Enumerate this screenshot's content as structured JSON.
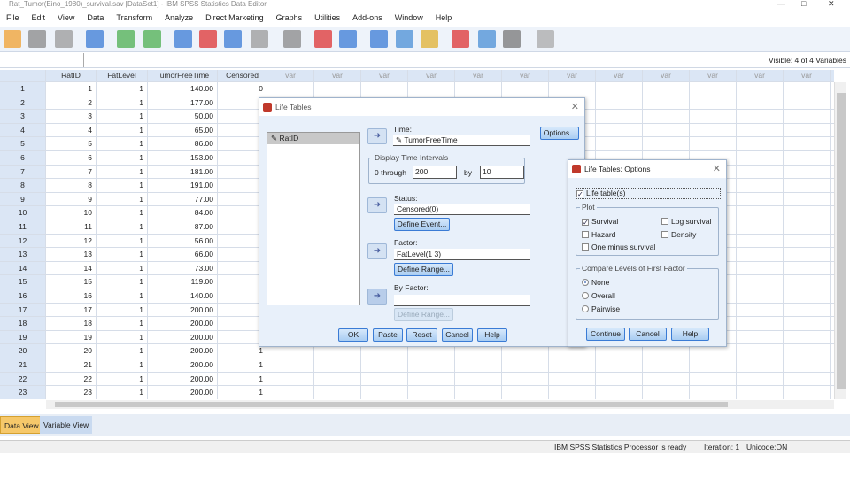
{
  "window": {
    "title": "Rat_Tumor(Eino_1980)_survival.sav [DataSet1] - IBM SPSS Statistics Data Editor"
  },
  "menu": [
    "File",
    "Edit",
    "View",
    "Data",
    "Transform",
    "Analyze",
    "Direct Marketing",
    "Graphs",
    "Utilities",
    "Add-ons",
    "Window",
    "Help"
  ],
  "editbar": {
    "visible": "Visible: 4 of 4 Variables"
  },
  "grid": {
    "columns": [
      "RatID",
      "FatLevel",
      "TumorFreeTime",
      "Censored",
      "var",
      "var",
      "var",
      "var",
      "var",
      "var",
      "var",
      "var",
      "var",
      "var",
      "var",
      "var",
      "var"
    ],
    "rows": [
      [
        "1",
        "1",
        "1",
        "140.00",
        "0"
      ],
      [
        "2",
        "2",
        "1",
        "177.00",
        ""
      ],
      [
        "3",
        "3",
        "1",
        "50.00",
        ""
      ],
      [
        "4",
        "4",
        "1",
        "65.00",
        ""
      ],
      [
        "5",
        "5",
        "1",
        "86.00",
        ""
      ],
      [
        "6",
        "6",
        "1",
        "153.00",
        ""
      ],
      [
        "7",
        "7",
        "1",
        "181.00",
        ""
      ],
      [
        "8",
        "8",
        "1",
        "191.00",
        ""
      ],
      [
        "9",
        "9",
        "1",
        "77.00",
        ""
      ],
      [
        "10",
        "10",
        "1",
        "84.00",
        ""
      ],
      [
        "11",
        "11",
        "1",
        "87.00",
        ""
      ],
      [
        "12",
        "12",
        "1",
        "56.00",
        ""
      ],
      [
        "13",
        "13",
        "1",
        "66.00",
        ""
      ],
      [
        "14",
        "14",
        "1",
        "73.00",
        ""
      ],
      [
        "15",
        "15",
        "1",
        "119.00",
        ""
      ],
      [
        "16",
        "16",
        "1",
        "140.00",
        ""
      ],
      [
        "17",
        "17",
        "1",
        "200.00",
        ""
      ],
      [
        "18",
        "18",
        "1",
        "200.00",
        ""
      ],
      [
        "19",
        "19",
        "1",
        "200.00",
        ""
      ],
      [
        "20",
        "20",
        "1",
        "200.00",
        "1"
      ],
      [
        "21",
        "21",
        "1",
        "200.00",
        "1"
      ],
      [
        "22",
        "22",
        "1",
        "200.00",
        "1"
      ],
      [
        "23",
        "23",
        "1",
        "200.00",
        "1"
      ]
    ]
  },
  "tabs": {
    "data_view": "Data View",
    "variable_view": "Variable View"
  },
  "status": {
    "processor": "IBM SPSS Statistics Processor is ready",
    "iteration": "Iteration: 1",
    "unicode": "Unicode:ON"
  },
  "life_tables": {
    "title": "Life Tables",
    "source_var": "RatID",
    "time_label": "Time:",
    "time_value": "TumorFreeTime",
    "options_button": "Options...",
    "interval_group": "Display Time Intervals",
    "through_prefix": "0 through",
    "through_value": "200",
    "by_label": "by",
    "by_value": "10",
    "status_label": "Status:",
    "status_value": "Censored(0)",
    "define_event": "Define Event...",
    "factor_label": "Factor:",
    "factor_value": "FatLevel(1 3)",
    "define_range": "Define Range...",
    "byfactor_label": "By Factor:",
    "byfactor_value": "",
    "define_range2": "Define Range...",
    "buttons": [
      "OK",
      "Paste",
      "Reset",
      "Cancel",
      "Help"
    ]
  },
  "options": {
    "title": "Life Tables: Options",
    "life_tables": "Life table(s)",
    "plot_group": "Plot",
    "survival": "Survival",
    "log_survival": "Log survival",
    "hazard": "Hazard",
    "density": "Density",
    "one_minus": "One minus survival",
    "compare_group": "Compare Levels of First Factor",
    "none": "None",
    "overall": "Overall",
    "pairwise": "Pairwise",
    "buttons": [
      "Continue",
      "Cancel",
      "Help"
    ]
  }
}
